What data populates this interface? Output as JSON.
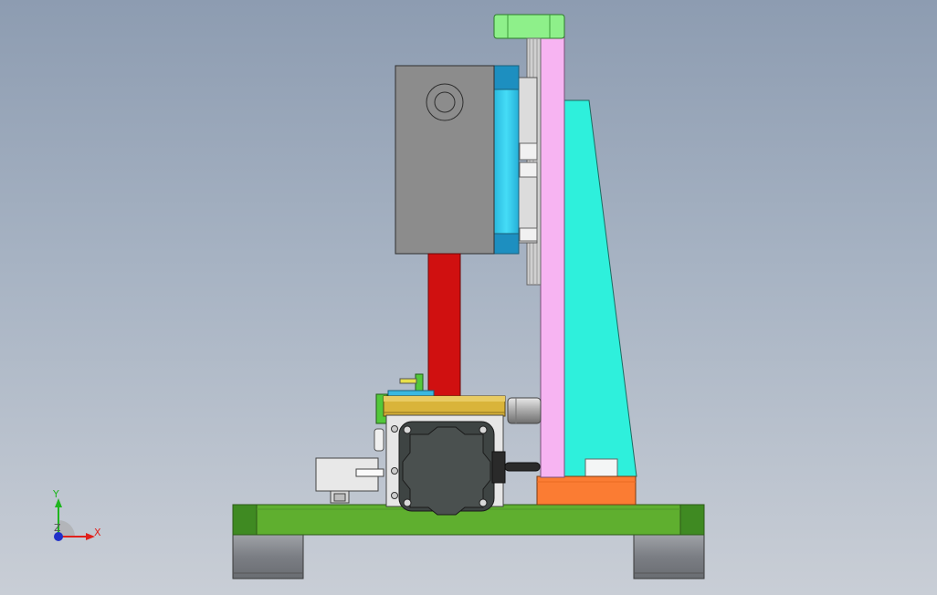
{
  "triad": {
    "x_label": "X",
    "y_label": "Y",
    "z_label": "Z",
    "x_color": "#e0201b",
    "y_color": "#1fb51f",
    "z_color": "#2030c8"
  },
  "colors": {
    "base_plate": "#5faf2f",
    "base_plate_dark": "#3f8a22",
    "feet": "#8c8e93",
    "upright_pink": "#f7b4f2",
    "gusset_cyan": "#2ef0dc",
    "top_cap_green": "#8ef08a",
    "motor_gray": "#8c8c8c",
    "flange_cyan": "#33d6f5",
    "red_column": "#d01010",
    "gold_plate": "#d9b43a",
    "orange_block": "#fb7c33",
    "stepper_dark": "#3e4443"
  },
  "components": [
    "base-plate",
    "foot-left",
    "foot-right",
    "vertical-upright",
    "triangular-gusset",
    "top-cap",
    "gearmotor-housing",
    "motor-flange",
    "red-column",
    "slide-table",
    "stepper-motor",
    "orange-mount-block",
    "limit-switch-bracket",
    "cylinder-stub"
  ]
}
